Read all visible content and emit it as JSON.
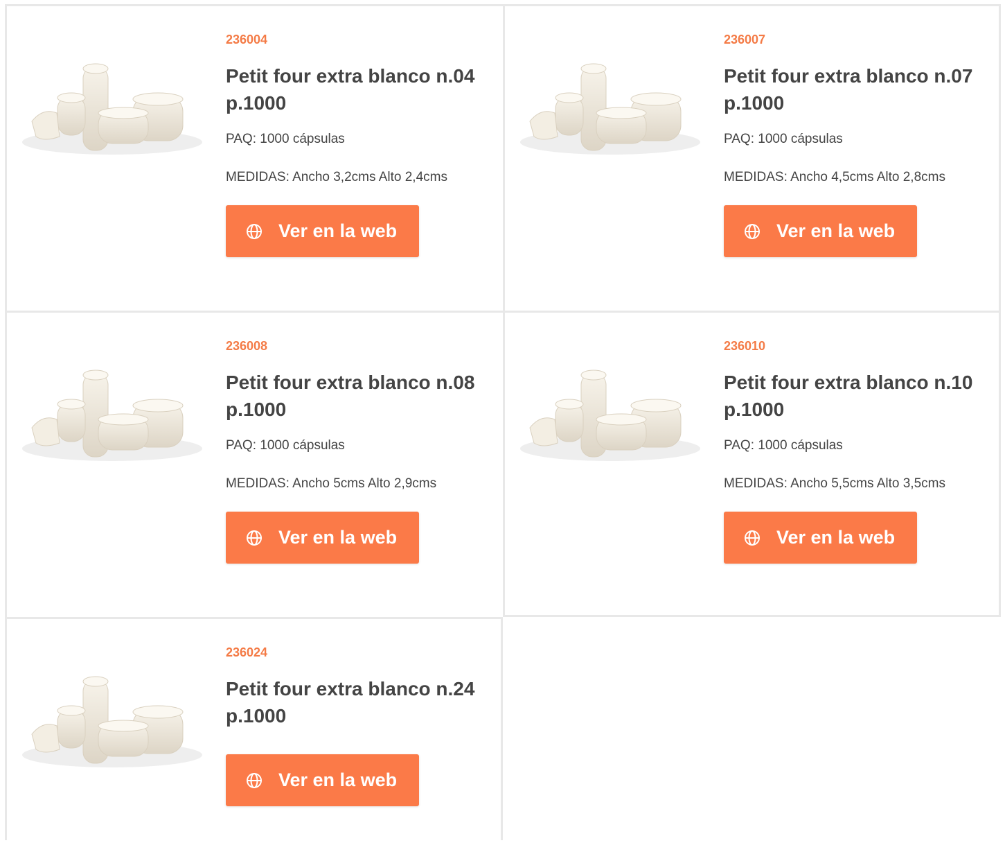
{
  "colors": {
    "accent": "#f47b46",
    "button": "#fb7a48",
    "text": "#444444",
    "border": "#e8e8e8"
  },
  "products": [
    {
      "code": "236004",
      "title": "Petit four extra blanco n.04 p.1000",
      "paq": "PAQ: 1000 cápsulas",
      "medidas": "MEDIDAS:  Ancho 3,2cms Alto 2,4cms",
      "button_label": "Ver en la web",
      "button_icon": "globe-icon"
    },
    {
      "code": "236007",
      "title": "Petit four extra blanco n.07 p.1000",
      "paq": "PAQ: 1000 cápsulas",
      "medidas": "MEDIDAS:  Ancho 4,5cms Alto 2,8cms",
      "button_label": "Ver en la web",
      "button_icon": "globe-icon"
    },
    {
      "code": "236008",
      "title": "Petit four extra blanco n.08 p.1000",
      "paq": "PAQ: 1000 cápsulas",
      "medidas": "MEDIDAS:  Ancho 5cms Alto 2,9cms",
      "button_label": "Ver en la web",
      "button_icon": "globe-icon"
    },
    {
      "code": "236010",
      "title": "Petit four extra blanco n.10 p.1000",
      "paq": "PAQ: 1000 cápsulas",
      "medidas": "MEDIDAS:  Ancho 5,5cms Alto 3,5cms",
      "button_label": "Ver en la web",
      "button_icon": "globe-icon"
    },
    {
      "code": "236024",
      "title": "Petit four extra blanco n.24 p.1000",
      "button_label": "Ver en la web",
      "button_icon": "globe-icon"
    }
  ]
}
